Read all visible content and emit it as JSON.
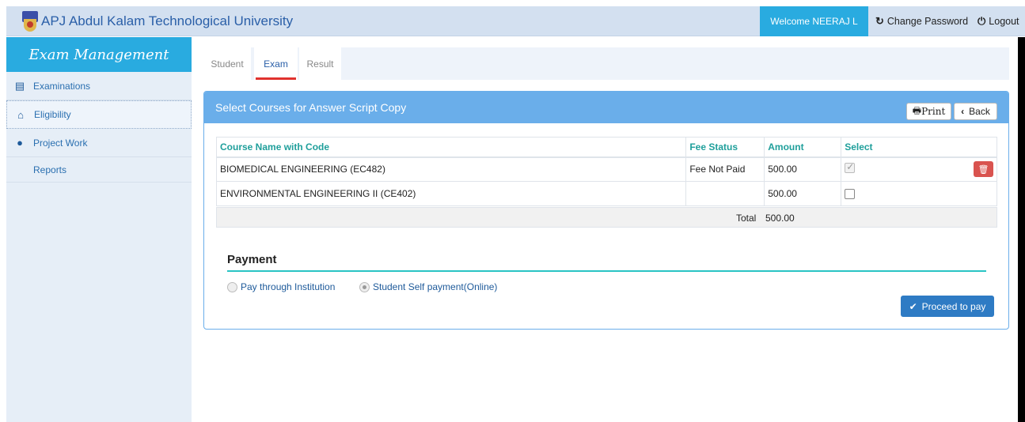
{
  "header": {
    "title": "APJ Abdul Kalam Technological University",
    "welcome": "Welcome NEERAJ L",
    "change_password": "Change Password",
    "logout": "Logout",
    "change_password_icon": "↻",
    "logout_icon": "⏻"
  },
  "sidebar": {
    "title": "Exam Management",
    "items": [
      {
        "label": "Examinations",
        "icon": "list-icon",
        "glyph": "▤"
      },
      {
        "label": "Eligibility",
        "icon": "home-icon",
        "glyph": "⌂"
      },
      {
        "label": "Project Work",
        "icon": "user-icon",
        "glyph": "●"
      },
      {
        "label": "Reports",
        "icon": "",
        "glyph": ""
      }
    ]
  },
  "tabs": [
    {
      "label": "Student"
    },
    {
      "label": "Exam"
    },
    {
      "label": "Result"
    }
  ],
  "panel": {
    "title": "Select Courses for Answer Script Copy",
    "print_label": "Print",
    "back_label": "Back",
    "columns": [
      "Course Name with Code",
      "Fee Status",
      "Amount",
      "Select"
    ],
    "rows": [
      {
        "course": "BIOMEDICAL ENGINEERING (EC482)",
        "fee_status": "Fee Not Paid",
        "amount": "500.00",
        "selected": true
      },
      {
        "course": "ENVIRONMENTAL ENGINEERING II (CE402)",
        "fee_status": "",
        "amount": "500.00",
        "selected": false
      }
    ],
    "total_label": "Total",
    "total_value": "500.00"
  },
  "payment": {
    "title": "Payment",
    "options": [
      {
        "label": "Pay through Institution",
        "selected": false
      },
      {
        "label": "Student Self payment(Online)",
        "selected": true
      }
    ],
    "proceed_label": "Proceed to pay"
  },
  "colors": {
    "accent": "#29abe0",
    "panel_header": "#6aaeea",
    "danger": "#d9534f",
    "primary": "#2e7bc4"
  }
}
